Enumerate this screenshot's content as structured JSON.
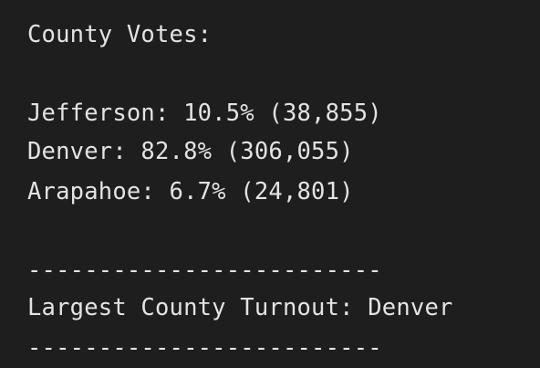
{
  "output": {
    "heading": "County Votes:",
    "counties": [
      {
        "line": "Jefferson: 10.5% (38,855)"
      },
      {
        "line": "Denver: 82.8% (306,055)"
      },
      {
        "line": "Arapahoe: 6.7% (24,801)"
      }
    ],
    "separator_top": "-------------------------",
    "largest_turnout": "Largest County Turnout: Denver",
    "separator_bottom": "-------------------------"
  },
  "colors": {
    "background": "#1e1e1e",
    "text": "#e3e3e3"
  }
}
